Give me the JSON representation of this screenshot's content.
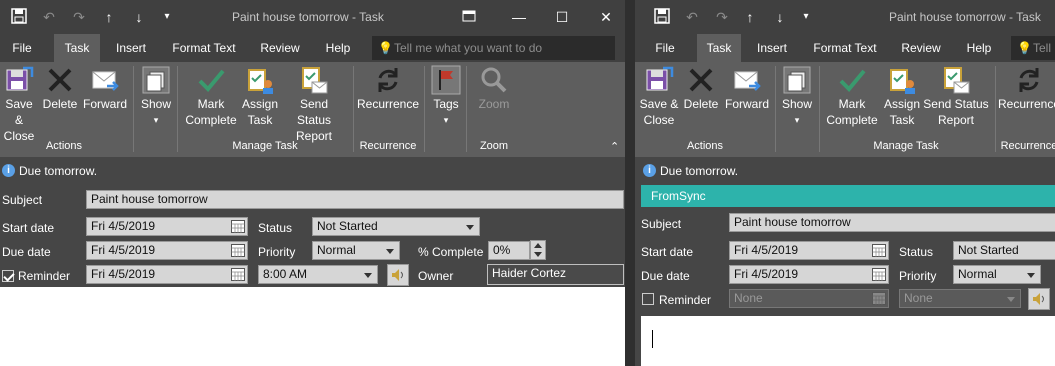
{
  "left": {
    "title": "Paint house tomorrow - Task",
    "tabs": [
      "File",
      "Task",
      "Insert",
      "Format Text",
      "Review",
      "Help"
    ],
    "active_tab": "Task",
    "tellme_placeholder": "Tell me what you want to do",
    "ribbon": {
      "save_close": [
        "Save &",
        "Close"
      ],
      "delete": "Delete",
      "forward": "Forward",
      "show": "Show",
      "mark_complete": [
        "Mark",
        "Complete"
      ],
      "assign_task": [
        "Assign",
        "Task"
      ],
      "send_status_report": [
        "Send Status",
        "Report"
      ],
      "recurrence": "Recurrence",
      "tags": "Tags",
      "zoom": "Zoom",
      "groups": {
        "actions": "Actions",
        "manage_task": "Manage Task",
        "recurrence": "Recurrence",
        "zoom": "Zoom"
      }
    },
    "info": "Due tomorrow.",
    "form": {
      "subject_label": "Subject",
      "subject": "Paint house tomorrow",
      "start_label": "Start date",
      "start": "Fri 4/5/2019",
      "due_label": "Due date",
      "due": "Fri 4/5/2019",
      "reminder_label": "Reminder",
      "reminder_checked": true,
      "reminder_date": "Fri 4/5/2019",
      "reminder_time": "8:00 AM",
      "status_label": "Status",
      "status": "Not Started",
      "priority_label": "Priority",
      "priority": "Normal",
      "complete_label": "% Complete",
      "complete": "0%",
      "owner_label": "Owner",
      "owner": "Haider Cortez"
    }
  },
  "right": {
    "title": "Paint house tomorrow - Task",
    "tabs": [
      "File",
      "Task",
      "Insert",
      "Format Text",
      "Review",
      "Help"
    ],
    "active_tab": "Task",
    "tellme_placeholder": "Tell",
    "ribbon": {
      "save_close": [
        "Save &",
        "Close"
      ],
      "delete": "Delete",
      "forward": "Forward",
      "show": "Show",
      "mark_complete": [
        "Mark",
        "Complete"
      ],
      "assign_task": [
        "Assign",
        "Task"
      ],
      "send_status_report": [
        "Send Status",
        "Report"
      ],
      "recurrence": "Recurrence",
      "groups": {
        "actions": "Actions",
        "manage_task": "Manage Task",
        "recurrence": "Recurrence"
      }
    },
    "info": "Due tomorrow.",
    "sync_label": "FromSync",
    "form": {
      "subject_label": "Subject",
      "subject": "Paint house tomorrow",
      "start_label": "Start date",
      "start": "Fri 4/5/2019",
      "due_label": "Due date",
      "due": "Fri 4/5/2019",
      "reminder_label": "Reminder",
      "reminder_checked": false,
      "reminder_date": "None",
      "reminder_time": "None",
      "status_label": "Status",
      "status": "Not Started",
      "priority_label": "Priority",
      "priority": "Normal"
    }
  },
  "colors": {
    "ribbon": "#5e5e5e",
    "titlebar": "#404040",
    "accent_sync": "#2db3ab",
    "check_green": "#3a9a6e",
    "flag_red": "#c0392b",
    "info_blue": "#5aa0e6"
  }
}
